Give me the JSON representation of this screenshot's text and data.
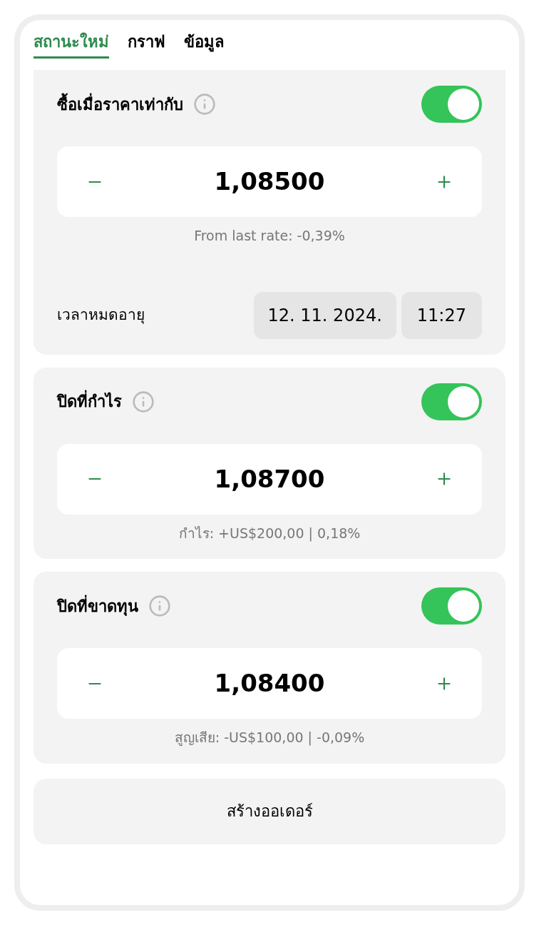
{
  "tabs": [
    {
      "label": "สถานะใหม่",
      "selected": true
    },
    {
      "label": "กราฟ",
      "selected": false
    },
    {
      "label": "ข้อมูล",
      "selected": false
    }
  ],
  "sections": [
    {
      "title": "ซื้อเมื่อราคาเท่ากับ",
      "on": true,
      "value": "1,08500",
      "note": "From last rate: -0,39%",
      "expiry": {
        "label": "เวลาหมดอายุ",
        "date": "12. 11. 2024.",
        "time": "11:27"
      }
    },
    {
      "title": "ปิดที่กำไร",
      "on": true,
      "value": "1,08700",
      "note": "กำไร: +US$200,00 | 0,18%"
    },
    {
      "title": "ปิดที่ขาดทุน",
      "on": true,
      "value": "1,08400",
      "note": "สูญเสีย: -US$100,00 | -0,09%"
    }
  ],
  "create_button": "สร้างออเดอร์"
}
